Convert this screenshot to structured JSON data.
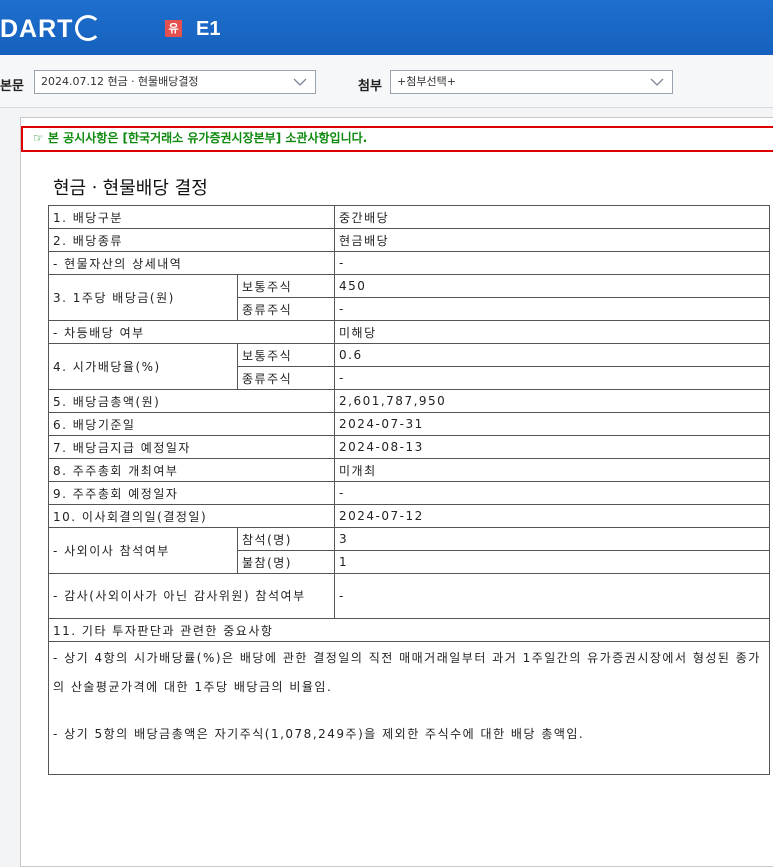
{
  "header": {
    "logo": "DART",
    "corp_badge": "유",
    "corp_name": "E1"
  },
  "selectors": {
    "main_label": "본문",
    "main_value": "2024.07.12  현금ㆍ현물배당결정",
    "attach_label": "첨부",
    "attach_value": "+첨부선택+"
  },
  "notice": "☞ 본 공시사항은 [한국거래소 유가증권시장본부] 소관사항입니다.",
  "doc_title": "현금ㆍ현물배당 결정",
  "table": {
    "r1": {
      "label": "1. 배당구분",
      "value": "중간배당"
    },
    "r2": {
      "label": "2. 배당종류",
      "value": "현금배당"
    },
    "r3": {
      "label": "- 현물자산의 상세내역",
      "value": "-"
    },
    "r4": {
      "label": "3. 1주당 배당금(원)",
      "sub1": "보통주식",
      "val1": "450",
      "sub2": "종류주식",
      "val2": "-"
    },
    "r5": {
      "label": "- 차등배당 여부",
      "value": "미해당"
    },
    "r6": {
      "label": "4. 시가배당율(%)",
      "sub1": "보통주식",
      "val1": "0.6",
      "sub2": "종류주식",
      "val2": "-"
    },
    "r7": {
      "label": "5. 배당금총액(원)",
      "value": "2,601,787,950"
    },
    "r8": {
      "label": "6. 배당기준일",
      "value": "2024-07-31"
    },
    "r9": {
      "label": "7. 배당금지급 예정일자",
      "value": "2024-08-13"
    },
    "r10": {
      "label": "8. 주주총회 개최여부",
      "value": "미개최"
    },
    "r11": {
      "label": "9. 주주총회 예정일자",
      "value": "-"
    },
    "r12": {
      "label": "10. 이사회결의일(결정일)",
      "value": "2024-07-12"
    },
    "r13": {
      "label": "- 사외이사 참석여부",
      "sub1": "참석(명)",
      "val1": "3",
      "sub2": "불참(명)",
      "val2": "1"
    },
    "r14": {
      "label": "- 감사(사외이사가 아닌 감사위원) 참석여부",
      "value": "-"
    },
    "r15": {
      "label": "11. 기타 투자판단과 관련한 중요사항"
    },
    "notes": {
      "p1": "- 상기 4항의 시가배당률(%)은 배당에 관한 결정일의 직전 매매거래일부터 과거 1주일간의 유가증권시장에서 형성된 종가의 산술평균가격에 대한 1주당 배당금의 비율임.",
      "p2": "- 상기 5항의 배당금총액은 자기주식(1,078,249주)을 제외한 주식수에 대한 배당 총액임."
    }
  }
}
